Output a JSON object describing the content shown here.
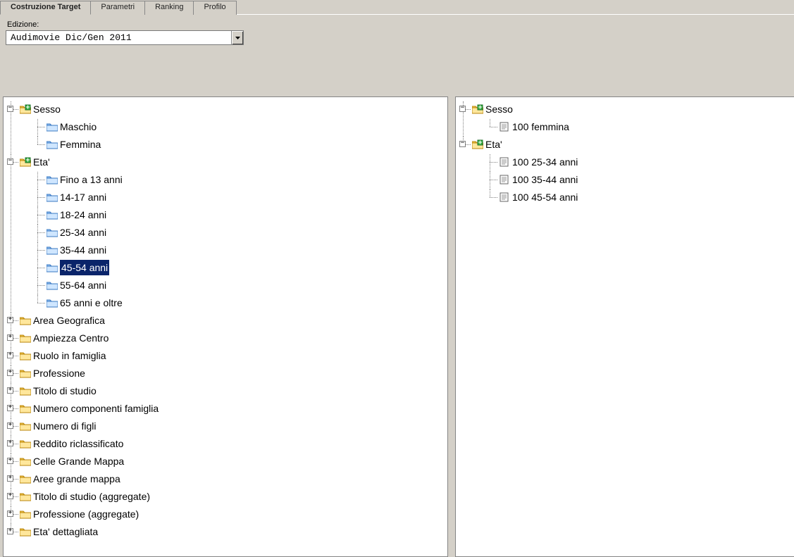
{
  "tabs": [
    {
      "label": "Costruzione Target",
      "active": true
    },
    {
      "label": "Parametri",
      "active": false
    },
    {
      "label": "Ranking",
      "active": false
    },
    {
      "label": "Profilo",
      "active": false
    }
  ],
  "edition": {
    "label": "Edizione:",
    "value": "Audimovie Dic/Gen 2011"
  },
  "leftTree": [
    {
      "label": "Sesso",
      "icon": "folder-target",
      "expander": "minus",
      "expanded": true,
      "children": [
        {
          "label": "Maschio",
          "icon": "folder-blue"
        },
        {
          "label": "Femmina",
          "icon": "folder-blue"
        }
      ]
    },
    {
      "label": "Eta'",
      "icon": "folder-target",
      "expander": "minus",
      "expanded": true,
      "children": [
        {
          "label": "Fino a 13 anni",
          "icon": "folder-blue"
        },
        {
          "label": "14-17 anni",
          "icon": "folder-blue"
        },
        {
          "label": "18-24 anni",
          "icon": "folder-blue"
        },
        {
          "label": "25-34 anni",
          "icon": "folder-blue"
        },
        {
          "label": "35-44 anni",
          "icon": "folder-blue"
        },
        {
          "label": "45-54 anni",
          "icon": "folder-blue",
          "selected": true
        },
        {
          "label": "55-64 anni",
          "icon": "folder-blue"
        },
        {
          "label": "65 anni e oltre",
          "icon": "folder-blue"
        }
      ]
    },
    {
      "label": "Area Geografica",
      "icon": "folder-yellow",
      "expander": "plus"
    },
    {
      "label": "Ampiezza Centro",
      "icon": "folder-yellow",
      "expander": "plus"
    },
    {
      "label": "Ruolo in famiglia",
      "icon": "folder-yellow",
      "expander": "plus"
    },
    {
      "label": "Professione",
      "icon": "folder-yellow",
      "expander": "plus"
    },
    {
      "label": "Titolo di studio",
      "icon": "folder-yellow",
      "expander": "plus"
    },
    {
      "label": "Numero componenti famiglia",
      "icon": "folder-yellow",
      "expander": "plus"
    },
    {
      "label": "Numero di figli",
      "icon": "folder-yellow",
      "expander": "plus"
    },
    {
      "label": "Reddito riclassificato",
      "icon": "folder-yellow",
      "expander": "plus"
    },
    {
      "label": "Celle Grande Mappa",
      "icon": "folder-yellow",
      "expander": "plus"
    },
    {
      "label": "Aree grande mappa",
      "icon": "folder-yellow",
      "expander": "plus"
    },
    {
      "label": "Titolo di studio (aggregate)",
      "icon": "folder-yellow",
      "expander": "plus"
    },
    {
      "label": "Professione (aggregate)",
      "icon": "folder-yellow",
      "expander": "plus"
    },
    {
      "label": "Eta' dettagliata",
      "icon": "folder-yellow",
      "expander": "plus"
    }
  ],
  "rightTree": [
    {
      "label": "Sesso",
      "icon": "folder-target",
      "expander": "minus",
      "expanded": true,
      "children": [
        {
          "label": "100 femmina",
          "icon": "page"
        }
      ]
    },
    {
      "label": "Eta'",
      "icon": "folder-target",
      "expander": "minus",
      "expanded": true,
      "children": [
        {
          "label": "100 25-34 anni",
          "icon": "page"
        },
        {
          "label": "100 35-44 anni",
          "icon": "page"
        },
        {
          "label": "100 45-54 anni",
          "icon": "page"
        }
      ]
    }
  ]
}
